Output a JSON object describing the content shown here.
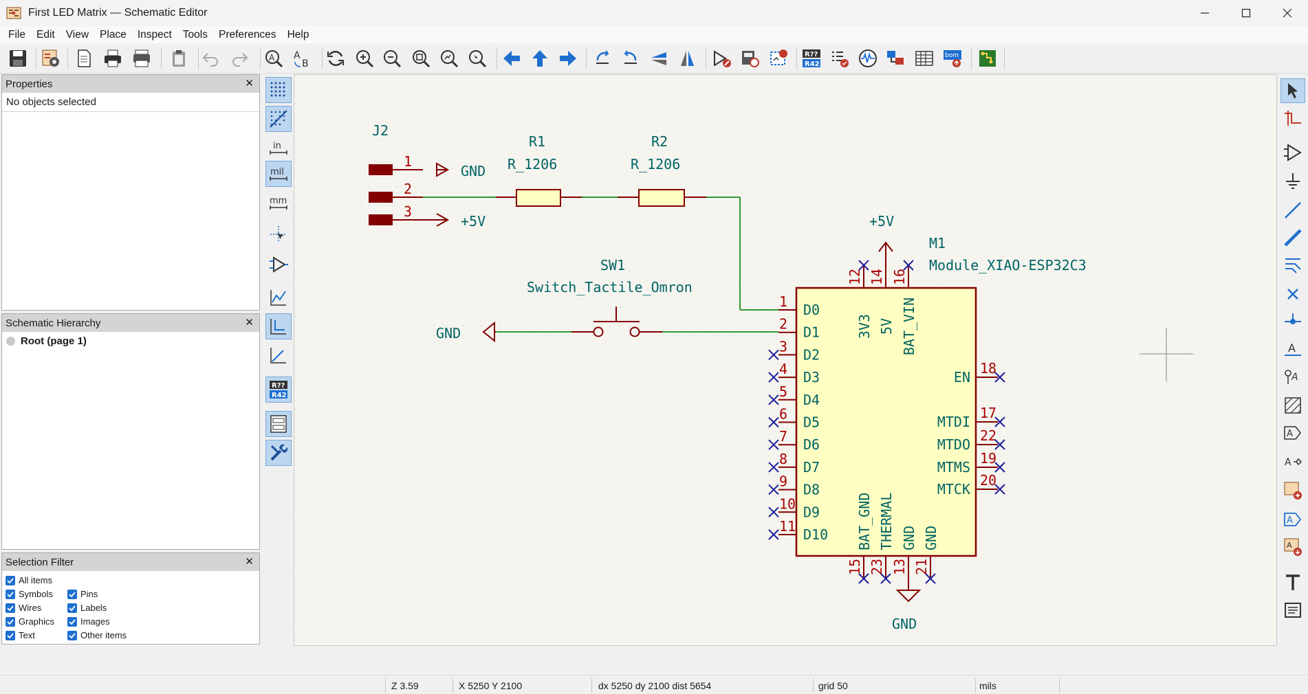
{
  "window": {
    "title": "First LED Matrix — Schematic Editor"
  },
  "menu": [
    "File",
    "Edit",
    "View",
    "Place",
    "Inspect",
    "Tools",
    "Preferences",
    "Help"
  ],
  "properties_panel": {
    "title": "Properties",
    "empty_text": "No objects selected"
  },
  "hierarchy_panel": {
    "title": "Schematic Hierarchy",
    "root_label": "Root (page 1)"
  },
  "selection_filter": {
    "title": "Selection Filter",
    "items": [
      {
        "label": "All items",
        "checked": true
      },
      {
        "label": "Symbols",
        "checked": true
      },
      {
        "label": "Pins",
        "checked": true
      },
      {
        "label": "Wires",
        "checked": true
      },
      {
        "label": "Labels",
        "checked": true
      },
      {
        "label": "Graphics",
        "checked": true
      },
      {
        "label": "Images",
        "checked": true
      },
      {
        "label": "Text",
        "checked": true
      },
      {
        "label": "Other items",
        "checked": true
      }
    ]
  },
  "left_toolbar": {
    "unit_in": "in",
    "unit_mil": "mil",
    "unit_mm": "mm",
    "annotate_top": "R??",
    "annotate_bottom": "R42"
  },
  "toolbar": {
    "annotate_top": "R??",
    "annotate_bottom": "R42",
    "bom_label": "bom"
  },
  "schematic": {
    "j2": {
      "ref": "J2",
      "pins": [
        "1",
        "2",
        "3"
      ]
    },
    "gnd_label": "GND",
    "plus5v_label": "+5V",
    "r1": {
      "ref": "R1",
      "value": "R_1206"
    },
    "r2": {
      "ref": "R2",
      "value": "R_1206"
    },
    "sw1": {
      "ref": "SW1",
      "value": "Switch_Tactile_Omron"
    },
    "m1": {
      "ref": "M1",
      "value": "Module_XIAO-ESP32C3",
      "left_pins": [
        {
          "num": "1",
          "name": "D0"
        },
        {
          "num": "2",
          "name": "D1"
        },
        {
          "num": "3",
          "name": "D2"
        },
        {
          "num": "4",
          "name": "D3"
        },
        {
          "num": "5",
          "name": "D4"
        },
        {
          "num": "6",
          "name": "D5"
        },
        {
          "num": "7",
          "name": "D6"
        },
        {
          "num": "8",
          "name": "D7"
        },
        {
          "num": "9",
          "name": "D8"
        },
        {
          "num": "10",
          "name": "D9"
        },
        {
          "num": "11",
          "name": "D10"
        }
      ],
      "right_pins": [
        {
          "num": "18",
          "name": "EN"
        },
        {
          "num": "17",
          "name": "MTDI"
        },
        {
          "num": "22",
          "name": "MTDO"
        },
        {
          "num": "19",
          "name": "MTMS"
        },
        {
          "num": "20",
          "name": "MTCK"
        }
      ],
      "top_pins": [
        {
          "num": "12",
          "name": "3V3"
        },
        {
          "num": "14",
          "name": "5V"
        },
        {
          "num": "16",
          "name": "BAT_VIN"
        }
      ],
      "bottom_pins": [
        {
          "num": "15",
          "name": "BAT_GND"
        },
        {
          "num": "23",
          "name": "THERMAL"
        },
        {
          "num": "13",
          "name": "GND"
        },
        {
          "num": "21",
          "name": "GND"
        }
      ]
    },
    "colors": {
      "wire": "#2e9a2e",
      "symbol_body": "#fffec2",
      "symbol_outline": "#840000",
      "pin_text": "#a90000",
      "label_text": "#006464",
      "no_connect": "#1e1e9e",
      "canvas_bg": "#f5f4ef"
    }
  },
  "status": {
    "zoom": "Z 3.59",
    "coords": "X 5250  Y 2100",
    "delta": "dx 5250  dy 2100  dist 5654",
    "grid": "grid 50",
    "units": "mils"
  }
}
